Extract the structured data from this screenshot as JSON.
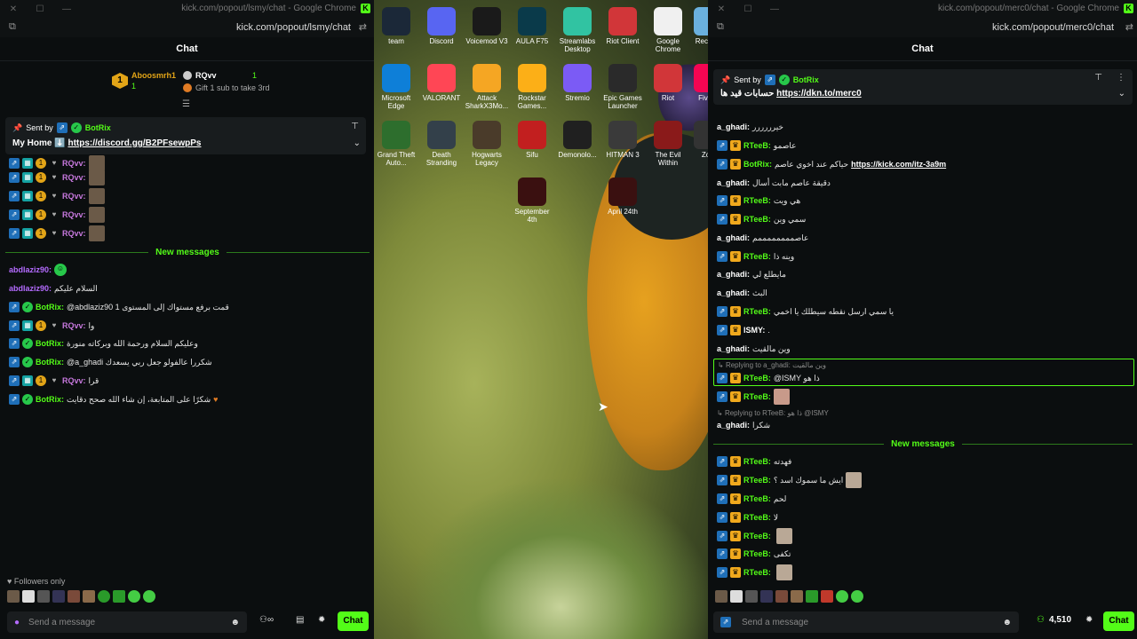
{
  "left_window": {
    "title": "kick.com/popout/lsmy/chat - Google Chrome",
    "url": "kick.com/popout/lsmy/chat",
    "header": "Chat",
    "leaderboard": {
      "first_name": "Aboosmrh1",
      "first_rank": "1",
      "first_count": "1",
      "second_name": "RQvv",
      "second_count": "1",
      "second_hint": "Gift 1 sub to take 3rd"
    },
    "pinned": {
      "sent_by_label": "Sent by",
      "sender": "BotRix",
      "text": "My Home ⬇️",
      "link": "https://discord.gg/B2PFsewpPs"
    },
    "messages_top": [
      {
        "user": "RQvv:"
      },
      {
        "user": "RQvv:"
      },
      {
        "user": "RQvv:"
      },
      {
        "user": "RQvv:"
      },
      {
        "user": "RQvv:"
      }
    ],
    "new_messages_label": "New messages",
    "messages": [
      {
        "user": "abdlaziz90:",
        "text": "",
        "color": "purple"
      },
      {
        "user": "abdlaziz90:",
        "text": "السلام عليكم",
        "color": "purple"
      },
      {
        "user": "BotRix:",
        "text": "@abdlaziz90 1 قمت برفع مستواك إلى المستوى",
        "color": "green"
      },
      {
        "user": "RQvv:",
        "text": "وا",
        "color": "violet"
      },
      {
        "user": "BotRix:",
        "text": "وعليكم السلام ورحمة الله وبركاته منورة",
        "color": "green"
      },
      {
        "user": "BotRix:",
        "text": "@a_ghadi شكررا عالفولو جعل ربي يسعدك",
        "color": "green"
      },
      {
        "user": "RQvv:",
        "text": "قرا",
        "color": "violet"
      },
      {
        "user": "BotRix:",
        "text": "شكرًا على المتابعة، إن شاء الله صحح دقايت",
        "color": "green"
      }
    ],
    "followers_only": "Followers only",
    "input_placeholder": "Send a message",
    "chat_button": "Chat"
  },
  "desktop": {
    "icons": [
      {
        "label": "team",
        "color": "#1b2838"
      },
      {
        "label": "Discord",
        "color": "#5865f2"
      },
      {
        "label": "Voicemod V3",
        "color": "#1a1a1a"
      },
      {
        "label": "AULA F75",
        "color": "#0a3a4a"
      },
      {
        "label": "Streamlabs Desktop",
        "color": "#31c3a2"
      },
      {
        "label": "Riot Client",
        "color": "#d13639"
      },
      {
        "label": "Google Chrome",
        "color": "#f0f0f0"
      },
      {
        "label": "Recycle",
        "color": "#6ab0de"
      },
      {
        "label": "Microsoft Edge",
        "color": "#0e7fd8"
      },
      {
        "label": "VALORANT",
        "color": "#ff4655"
      },
      {
        "label": "Attack SharkX3Mo...",
        "color": "#f5a623"
      },
      {
        "label": "Rockstar Games...",
        "color": "#fcaf17"
      },
      {
        "label": "Stremio",
        "color": "#7b5bf5"
      },
      {
        "label": "Epic Games Launcher",
        "color": "#2a2a2a"
      },
      {
        "label": "Riot",
        "color": "#d13639"
      },
      {
        "label": "FiveM",
        "color": "#f40552"
      },
      {
        "label": "Grand Theft Auto...",
        "color": "#2d6e2d"
      },
      {
        "label": "Death Stranding",
        "color": "#33404a"
      },
      {
        "label": "Hogwarts Legacy",
        "color": "#4a3b2a"
      },
      {
        "label": "Sifu",
        "color": "#c21f1f"
      },
      {
        "label": "Demonolo...",
        "color": "#202020"
      },
      {
        "label": "HITMAN 3",
        "color": "#3a3a3a"
      },
      {
        "label": "The Evil Within",
        "color": "#8a1a1a"
      },
      {
        "label": "Zort",
        "color": "#333333"
      },
      {
        "label": "September 4th",
        "color": "#3a1010"
      },
      {
        "label": "April 24th",
        "color": "#3a1010"
      }
    ]
  },
  "right_window": {
    "title": "kick.com/popout/merc0/chat - Google Chrome",
    "url": "kick.com/popout/merc0/chat",
    "header": "Chat",
    "pinned": {
      "sent_by_label": "Sent by",
      "sender": "BotRix",
      "text": "حسابات قيد ها",
      "link": "https://dkn.to/merc0"
    },
    "messages": [
      {
        "user": "a_ghadi:",
        "text": "خيرررررر",
        "color": "white",
        "badges": false
      },
      {
        "user": "RTeeB:",
        "text": "عاصمو",
        "color": "green",
        "badges": true
      },
      {
        "user": "BotRix:",
        "text": "حياكم عند اخوي عاصم",
        "link": "https://kick.com/itz-3a9m",
        "color": "green",
        "badges": true
      },
      {
        "user": "a_ghadi:",
        "text": "دقيقة عاصم مابت أسال",
        "color": "white",
        "badges": false
      },
      {
        "user": "RTeeB:",
        "text": "هي ويت",
        "color": "green",
        "badges": true
      },
      {
        "user": "RTeeB:",
        "text": "سمي وين",
        "color": "green",
        "badges": true
      },
      {
        "user": "a_ghadi:",
        "text": "عاصممممممممم",
        "color": "white",
        "badges": false
      },
      {
        "user": "RTeeB:",
        "text": "وينه ذا",
        "color": "green",
        "badges": true
      },
      {
        "user": "a_ghadi:",
        "text": "مايطلع لي",
        "color": "white",
        "badges": false
      },
      {
        "user": "a_ghadi:",
        "text": "البث",
        "color": "white",
        "badges": false
      },
      {
        "user": "RTeeB:",
        "text": "يا سمي ارسل نقطه سيطلك يا اخمي",
        "color": "green",
        "badges": true
      },
      {
        "user": "lSMY:",
        "text": ".",
        "color": "white",
        "badges": true
      },
      {
        "user": "a_ghadi:",
        "text": "وين مالقيت",
        "color": "white",
        "badges": false
      }
    ],
    "reply_1": {
      "label": "Replying to a_ghadi:",
      "quote": "وين مالقيت",
      "user": "RTeeB:",
      "text": "@ISMY ذا هو"
    },
    "reply_1_next": {
      "user": "RTeeB:"
    },
    "reply_2": {
      "label": "Replying to RTeeB:",
      "quote": "ذا هو @ISMY",
      "user": "a_ghadi:",
      "text": "شكرا"
    },
    "new_messages_label": "New messages",
    "messages_new": [
      {
        "user": "RTeeB:",
        "text": "فهدته",
        "emote": false
      },
      {
        "user": "RTeeB:",
        "text": "ايش ما سموك اسد ؟",
        "emote": true
      },
      {
        "user": "RTeeB:",
        "text": "لحم",
        "emote": false
      },
      {
        "user": "RTeeB:",
        "text": "لا",
        "emote": false
      },
      {
        "user": "RTeeB:",
        "text": "",
        "emote": true
      },
      {
        "user": "RTeeB:",
        "text": "تكفى",
        "emote": false
      },
      {
        "user": "RTeeB:",
        "text": "",
        "emote": true
      }
    ],
    "input_placeholder": "Send a message",
    "viewer_count": "4,510",
    "chat_button": "Chat"
  }
}
